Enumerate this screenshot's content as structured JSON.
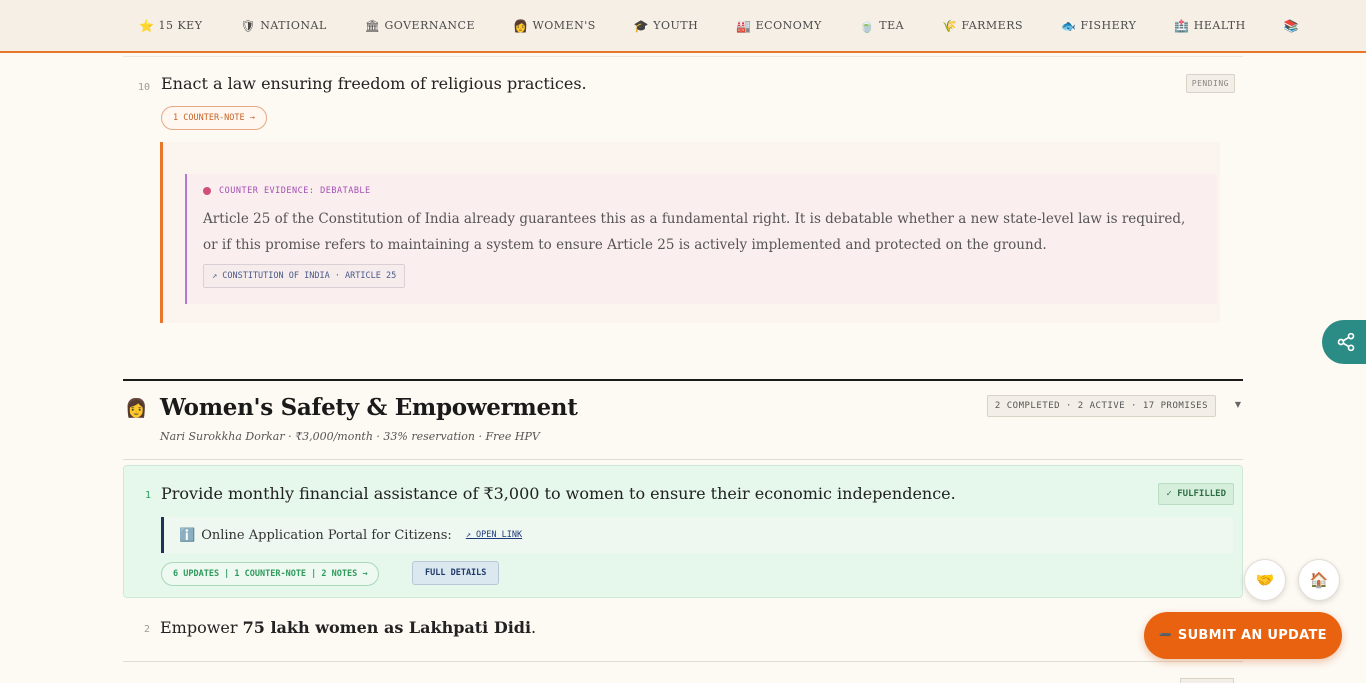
{
  "nav": {
    "items": [
      {
        "icon": "⭐",
        "label": "15 KEY"
      },
      {
        "icon": "🛡",
        "label": "NATIONAL"
      },
      {
        "icon": "🏛",
        "label": "GOVERNANCE"
      },
      {
        "icon": "👩",
        "label": "WOMEN'S"
      },
      {
        "icon": "🎓",
        "label": "YOUTH"
      },
      {
        "icon": "🏭",
        "label": "ECONOMY"
      },
      {
        "icon": "🍵",
        "label": "TEA"
      },
      {
        "icon": "🌾",
        "label": "FARMERS"
      },
      {
        "icon": "🐟",
        "label": "FISHERY"
      },
      {
        "icon": "🏥",
        "label": "HEALTH"
      },
      {
        "icon": "📚",
        "label": ""
      }
    ]
  },
  "promise10": {
    "number": "10",
    "title": "Enact a law ensuring freedom of religious practices.",
    "status": "PENDING",
    "counter_pill": "1 COUNTER-NOTE →",
    "evidence": {
      "heading": "COUNTER EVIDENCE: DEBATABLE",
      "body": "Article 25 of the Constitution of India already guarantees this as a fundamental right. It is debatable whether a new state-level law is required, or if this promise refers to maintaining a system to ensure Article 25 is actively implemented and protected on the ground.",
      "source": "↗ CONSTITUTION OF INDIA · ARTICLE 25"
    }
  },
  "section": {
    "icon": "👩",
    "title": "Women's Safety & Empowerment",
    "subtitle": "Nari Surokkha Dorkar · ₹3,000/month · 33% reservation · Free HPV",
    "stats": "2 COMPLETED · 2 ACTIVE · 17 PROMISES",
    "caret": "▼"
  },
  "item1": {
    "number": "1",
    "title": "Provide monthly financial assistance of ₹3,000 to women to ensure their economic independence.",
    "status": "✓ FULFILLED",
    "portal_icon": "ℹ️",
    "portal_label": "Online Application Portal for Citizens:",
    "portal_link": "↗ OPEN LINK",
    "updates_pill": "6 UPDATES | 1 COUNTER-NOTE | 2 NOTES →",
    "details_button": "FULL DETAILS"
  },
  "item2": {
    "number": "2",
    "title_prefix": "Empower ",
    "title_bold": "75 lakh women as Lakhpati Didi",
    "title_suffix": "."
  },
  "floating": {
    "submit_label": "SUBMIT AN UPDATE",
    "submit_icon": "➖",
    "handshake_icon": "🤝",
    "home_icon": "🏠"
  }
}
